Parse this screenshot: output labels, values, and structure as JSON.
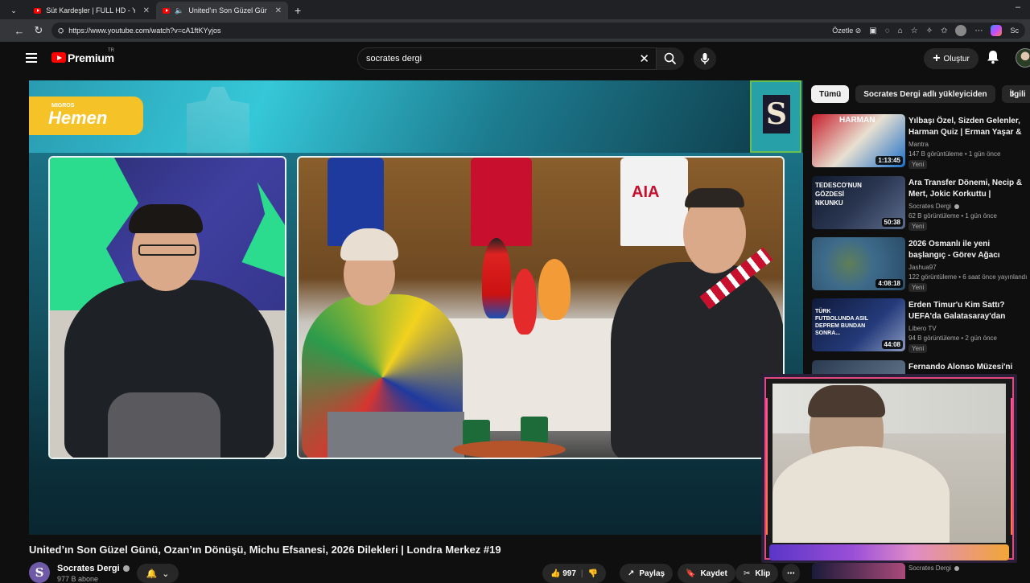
{
  "browser": {
    "tabs": [
      {
        "title": "Süt Kardeşler | FULL HD - YouTube",
        "active": false
      },
      {
        "title": "United'ın Son Güzel Günü, Oz",
        "active": true
      }
    ],
    "url": "https://www.youtube.com/watch?v=cA1ftKYyjos",
    "summarize_label": "Özetle",
    "profile_label": "Sc"
  },
  "header": {
    "logo_text": "Premium",
    "logo_region": "TR",
    "search_value": "socrates dergi",
    "create_label": "Oluştur"
  },
  "player": {
    "overlay_brand_small": "MIGROS",
    "overlay_brand": "Hemen",
    "badge_letter": "S",
    "jersey_text": "AIA"
  },
  "video": {
    "title": "United’ın Son Güzel Günü, Ozan’ın Dönüşü, Michu Efsanesi, 2026 Dilekleri | Londra Merkez #19",
    "channel_name": "Socrates Dergi",
    "channel_initial": "S",
    "subscribers": "977 B abone",
    "likes": "997",
    "share_label": "Paylaş",
    "save_label": "Kaydet",
    "clip_label": "Klip"
  },
  "sidebar": {
    "chips": [
      "Tümü",
      "Socrates Dergi adlı yükleyiciden",
      "İlgili"
    ],
    "recommendations": [
      {
        "title": "Yılbaşı Özel, Sizden Gelenler, Harman Quiz | Erman Yaşar & ...",
        "channel": "Mantra",
        "meta": "147 B görüntüleme • 1 gün önce",
        "duration": "1:13:45",
        "badge": "Yeni",
        "thumb_text": "HARMAN"
      },
      {
        "title": "Ara Transfer Dönemi, Necip & Mert, Jokic Korkuttu | Mehmet...",
        "channel": "Socrates Dergi",
        "meta": "62 B görüntüleme • 1 gün önce",
        "duration": "50:38",
        "badge": "Yeni",
        "thumb_text": "TEDESCO'NUN GÖZDESİ NKUNKU"
      },
      {
        "title": "2026 Osmanlı ile yeni başlangıç - Görev Ağacı tamamlamaca",
        "channel": "Jashua97",
        "meta": "122 görüntüleme • 6 saat önce yayınlandı",
        "duration": "4:08:18",
        "badge": "Yeni",
        "thumb_text": ""
      },
      {
        "title": "Erden Timur'u Kim Sattı? UEFA'da Galatasaray'dan Daha...",
        "channel": "Libero TV",
        "meta": "94 B görüntüleme • 2 gün önce",
        "duration": "44:08",
        "badge": "Yeni",
        "thumb_text": "TÜRK FUTBOLUNDA ASIL DEPREM BUNDAN SONRA..."
      },
      {
        "title": "Fernando Alonso Müzesi'ni Gezelim!",
        "channel": "",
        "meta": "",
        "duration": "",
        "badge": "",
        "thumb_text": ""
      }
    ],
    "bottom_channel": "Socrates Dergi"
  },
  "colors": {
    "yt_red": "#ff0000",
    "bg": "#0f0f0f",
    "chip_bg": "#272727",
    "hemen_yellow": "#f5c227",
    "accent_green": "#2bdc8e"
  }
}
